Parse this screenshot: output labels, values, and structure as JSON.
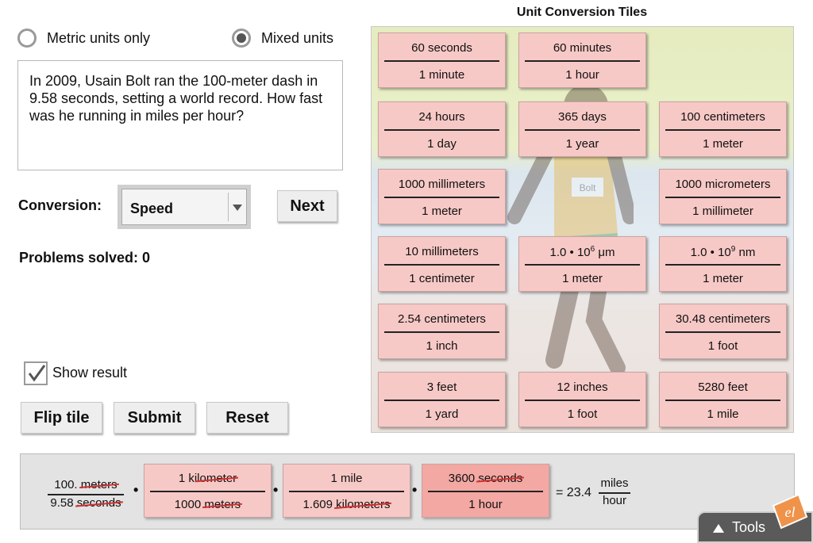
{
  "options": {
    "metric_label": "Metric units only",
    "mixed_label": "Mixed units",
    "selected": "mixed"
  },
  "problem": {
    "text": "In 2009, Usain Bolt ran the 100-meter dash in 9.58 seconds, setting a world record. How fast was he running in miles per hour?"
  },
  "conversion": {
    "label": "Conversion:",
    "selected_value": "Speed",
    "next_label": "Next"
  },
  "status": {
    "solved_text": "Problems solved: 0"
  },
  "show_result": {
    "label": "Show result",
    "checked": true
  },
  "buttons": {
    "flip": "Flip tile",
    "submit": "Submit",
    "reset": "Reset"
  },
  "tiles_panel": {
    "title": "Unit Conversion Tiles",
    "runner_bib": "Bolt",
    "tiles": [
      {
        "num": "60 seconds",
        "den": "1 minute"
      },
      {
        "num": "60 minutes",
        "den": "1 hour"
      },
      {
        "num": "24 hours",
        "den": "1 day"
      },
      {
        "num": "365 days",
        "den": "1 year"
      },
      {
        "num": "100 centimeters",
        "den": "1 meter"
      },
      {
        "num": "1000 millimeters",
        "den": "1 meter"
      },
      {
        "num": "1000 micrometers",
        "den": "1 millimeter"
      },
      {
        "num": "10 millimeters",
        "den": "1 centimeter"
      },
      {
        "num_pre": "1.0 • 10",
        "num_exp": "6",
        "num_post": " μm",
        "den": "1 meter"
      },
      {
        "num_pre": "1.0 • 10",
        "num_exp": "9",
        "num_post": " nm",
        "den": "1 meter"
      },
      {
        "num": "2.54 centimeters",
        "den": "1 inch"
      },
      {
        "num": "30.48 centimeters",
        "den": "1 foot"
      },
      {
        "num": "3 feet",
        "den": "1 yard"
      },
      {
        "num": "12 inches",
        "den": "1 foot"
      },
      {
        "num": "5280 feet",
        "den": "1 mile"
      }
    ]
  },
  "equation": {
    "start_num": "100.",
    "start_num_unit": "meters",
    "start_den": "9.58",
    "start_den_unit": "seconds",
    "dot": "•",
    "t1_num_a": "1 ki",
    "t1_num_b": "lometer",
    "t1_den_a": "1000 ",
    "t1_den_b": "meters",
    "t2_num": "1 mile",
    "t2_den_a": "1.609 ",
    "t2_den_b": "kilometers",
    "t3_num_a": "3600 ",
    "t3_num_b": "seconds",
    "t3_den": "1 hour",
    "result": "= 23.4",
    "unit_num": "miles",
    "unit_den": "hour"
  },
  "tools": {
    "label": "Tools"
  },
  "logo": {
    "text": "el"
  },
  "colors": {
    "tile": "#f7c9c6",
    "tile_active": "#f3a8a3",
    "strike": "#d03030",
    "logo": "#f0934a"
  }
}
